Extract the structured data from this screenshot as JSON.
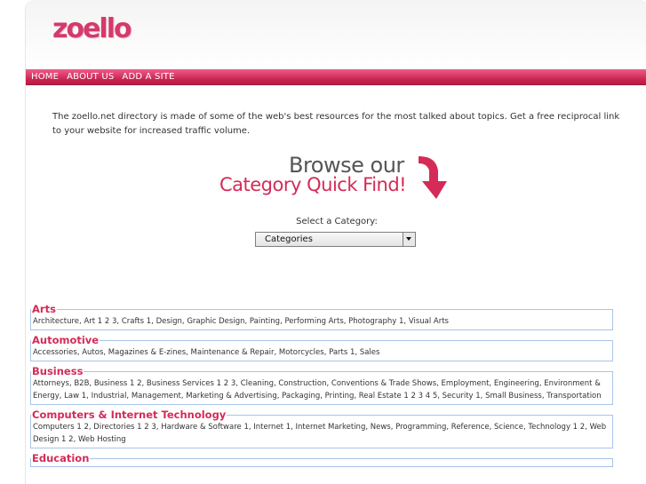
{
  "logo": "zoello",
  "nav": [
    "HOME",
    "ABOUT US",
    "ADD A SITE"
  ],
  "intro": "The zoello.net directory is made of some of the web's best resources for the most talked about topics. Get a free reciprocal link to your website for increased traffic volume.",
  "browse": {
    "line1": "Browse our",
    "line2": "Category Quick Find!"
  },
  "select": {
    "label": "Select a Category:",
    "value": "Categories"
  },
  "categories": [
    {
      "title": "Arts",
      "links": "Architecture,  Art  1  2  3,  Crafts  1,  Design,  Graphic Design,  Painting,  Performing Arts,  Photography  1,  Visual Arts"
    },
    {
      "title": "Automotive",
      "links": "Accessories,  Autos,  Magazines & E-zines,  Maintenance & Repair,  Motorcycles,  Parts  1,  Sales"
    },
    {
      "title": "Business",
      "links": "Attorneys,  B2B,  Business  1  2,  Business Services  1  2  3,  Cleaning,  Construction,  Conventions & Trade Shows,  Employment,  Engineering,  Environment & Energy,  Law  1,  Industrial,  Management,  Marketing & Advertising,  Packaging,  Printing,  Real Estate  1  2  3  4  5,  Security  1,  Small Business,  Transportation"
    },
    {
      "title": "Computers & Internet Technology",
      "links": "Computers  1  2,  Directories  1  2  3,  Hardware & Software  1,  Internet  1,  Internet Marketing,  News,  Programming,  Reference,  Science,  Technology  1  2,  Web Design  1  2,  Web Hosting"
    },
    {
      "title": "Education",
      "links": ""
    }
  ],
  "colors": {
    "accent": "#d42b58",
    "nav": "#c8234f",
    "border": "#a8c4e8"
  }
}
